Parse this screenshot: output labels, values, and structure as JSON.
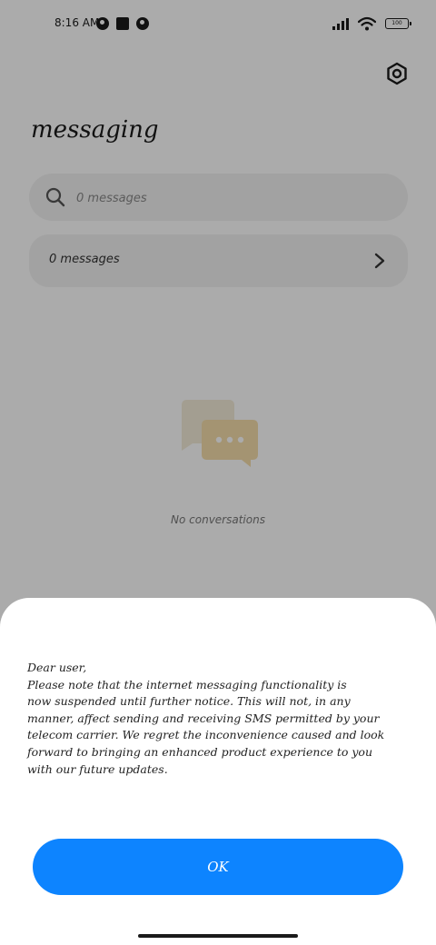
{
  "status_bar": {
    "time": "8:16 AM",
    "battery": "100"
  },
  "header": {
    "title": "messaging"
  },
  "search": {
    "placeholder": "0 messages"
  },
  "messages_row": {
    "label": "0 messages"
  },
  "empty_state": {
    "text": "No conversations"
  },
  "dialog": {
    "greeting": "Dear user,",
    "lines": [
      "Please note that the internet messaging functionality is",
      "now suspended until further notice. This will not, in any",
      "manner, affect sending and receiving SMS permitted by your",
      "telecom carrier. We regret the inconvenience caused and look",
      "forward to bringing an enhanced product experience to you",
      "with our future updates."
    ],
    "ok_label": "OK"
  },
  "icons": {
    "settings": "gear-icon",
    "search": "search-icon",
    "chevron": "chevron-right-icon",
    "empty": "chat-bubbles-icon"
  },
  "colors": {
    "accent": "#0d84ff",
    "illustration_back": "#f3ecd8",
    "illustration_front": "#f5ddaa"
  }
}
